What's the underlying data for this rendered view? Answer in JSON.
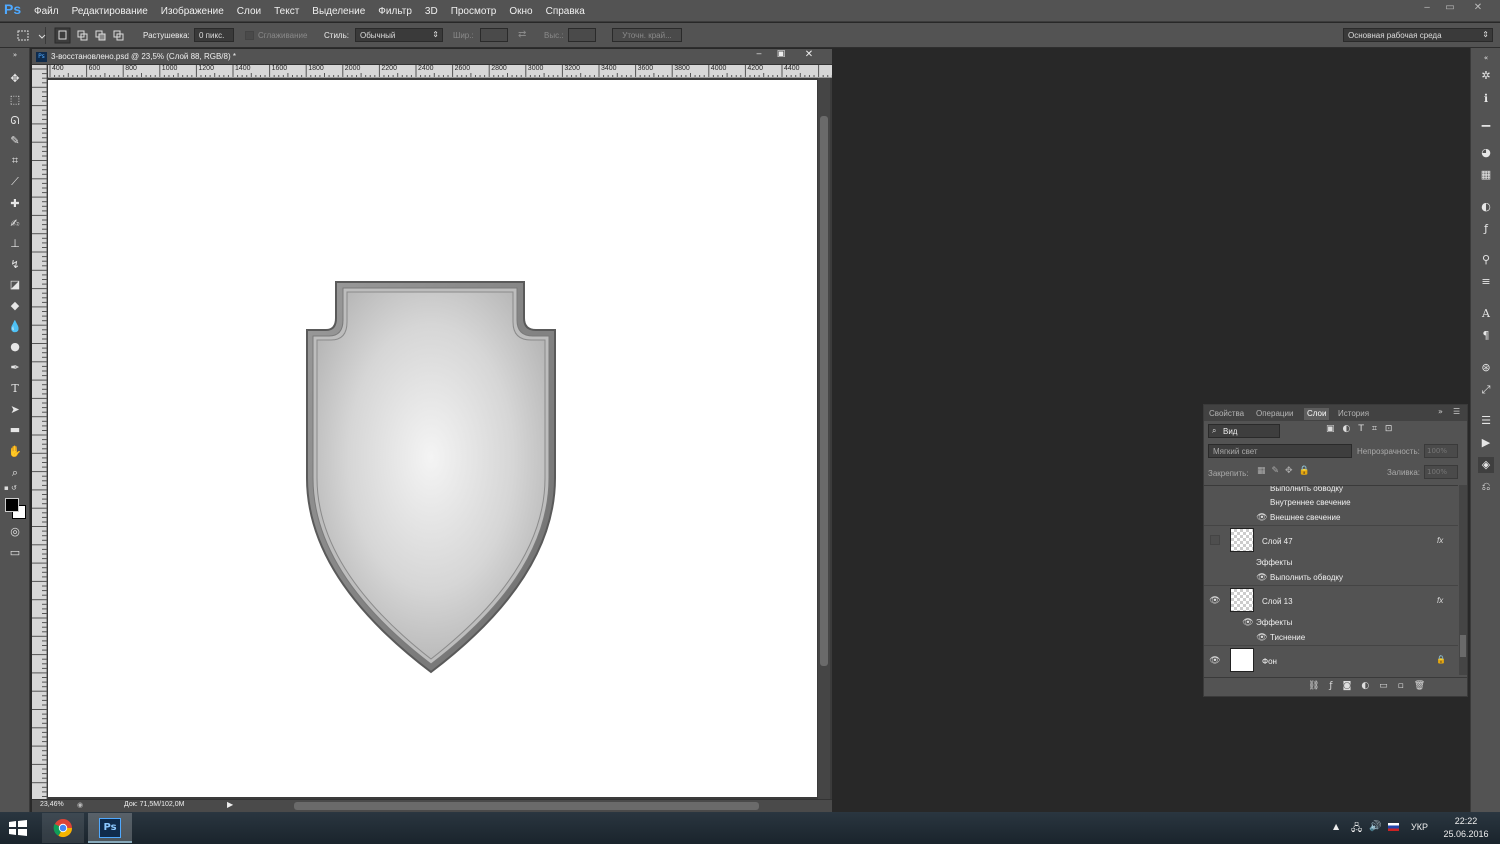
{
  "app": {
    "logo": "Ps",
    "window_controls": [
      "‒",
      "▭",
      "✕"
    ]
  },
  "menu": [
    "Файл",
    "Редактирование",
    "Изображение",
    "Слои",
    "Текст",
    "Выделение",
    "Фильтр",
    "3D",
    "Просмотр",
    "Окно",
    "Справка"
  ],
  "options": {
    "feather_label": "Растушевка:",
    "feather_value": "0 пикс.",
    "antialias_label": "Сглаживание",
    "style_label": "Стиль:",
    "style_value": "Обычный",
    "width_label": "Шир.:",
    "height_label": "Выс.:",
    "refine_label": "Уточн. край...",
    "workspace": "Основная рабочая среда"
  },
  "document": {
    "tab_title": "3-восстановлено.psd @ 23,5% (Слой 88, RGB/8) *",
    "ruler_ticks": [
      "400",
      "600",
      "800",
      "1000",
      "1200",
      "1400",
      "1600",
      "1800",
      "2000",
      "2200",
      "2400",
      "2600",
      "2800",
      "3000",
      "3200",
      "3400",
      "3600",
      "3800",
      "4000",
      "4200",
      "4400"
    ],
    "zoom": "23,46%",
    "doc_info": "Док: 71,5M/102,0M"
  },
  "panel": {
    "tabs": [
      "Свойства",
      "Операции",
      "Слои",
      "История"
    ],
    "active_tab": "Слои",
    "filter_label": "Вид",
    "blend_mode": "Мягкий свет",
    "opacity_label": "Непрозрачность:",
    "opacity_value": "100%",
    "lock_label": "Закрепить:",
    "fill_label": "Заливка:",
    "fill_value": "100%",
    "top_effects": [
      "Выполнить обводку",
      "Внутреннее свечение",
      "Внешнее свечение"
    ],
    "layers": [
      {
        "name": "Слой 47",
        "fx": "fx",
        "effects_label": "Эффекты",
        "effects": [
          "Выполнить обводку"
        ]
      },
      {
        "name": "Слой 13",
        "fx": "fx",
        "effects_label": "Эффекты",
        "effects": [
          "Тиснение"
        ]
      },
      {
        "name": "Фон"
      }
    ]
  },
  "taskbar": {
    "lang": "УКР",
    "time": "22:22",
    "date": "25.06.2016",
    "ps_label": "Ps"
  }
}
